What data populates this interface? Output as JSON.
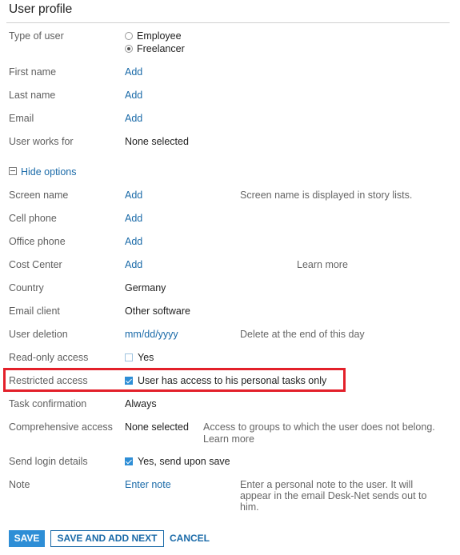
{
  "header": {
    "title": "User profile"
  },
  "type_of_user": {
    "label": "Type of user",
    "options": [
      "Employee",
      "Freelancer"
    ],
    "selected": "Freelancer"
  },
  "first_name": {
    "label": "First name",
    "value": "Add"
  },
  "last_name": {
    "label": "Last name",
    "value": "Add"
  },
  "email": {
    "label": "Email",
    "value": "Add"
  },
  "user_works_for": {
    "label": "User works for",
    "value": "None selected"
  },
  "options_toggle": {
    "label": "Hide options"
  },
  "screen_name": {
    "label": "Screen name",
    "value": "Add",
    "hint": "Screen name is displayed in story lists."
  },
  "cell_phone": {
    "label": "Cell phone",
    "value": "Add"
  },
  "office_phone": {
    "label": "Office phone",
    "value": "Add"
  },
  "cost_center": {
    "label": "Cost Center",
    "value": "Add",
    "learn_more": "Learn more"
  },
  "country": {
    "label": "Country",
    "value": "Germany"
  },
  "email_client": {
    "label": "Email client",
    "value": "Other software"
  },
  "user_deletion": {
    "label": "User deletion",
    "value": "mm/dd/yyyy",
    "hint": "Delete at the end of this day"
  },
  "read_only_access": {
    "label": "Read-only access",
    "checkbox_label": "Yes",
    "checked": false
  },
  "restricted_access": {
    "label": "Restricted access",
    "checkbox_label": "User has access to his personal tasks only",
    "checked": true
  },
  "task_confirmation": {
    "label": "Task confirmation",
    "value": "Always"
  },
  "comprehensive_access": {
    "label": "Comprehensive access",
    "value": "None selected",
    "hint": "Access to groups to which the user does not belong.",
    "learn_more": "Learn more"
  },
  "send_login_details": {
    "label": "Send login details",
    "checkbox_label": "Yes, send upon save",
    "checked": true
  },
  "note": {
    "label": "Note",
    "value": "Enter note",
    "hint": "Enter a personal note to the user. It will appear in the email Desk-Net sends out to him."
  },
  "actions": {
    "save": "SAVE",
    "save_and_add_next": "SAVE AND ADD NEXT",
    "cancel": "CANCEL"
  },
  "colors": {
    "link": "#1a6aa8",
    "primary_button": "#2e8ed6",
    "highlight_border": "#e3202a"
  }
}
